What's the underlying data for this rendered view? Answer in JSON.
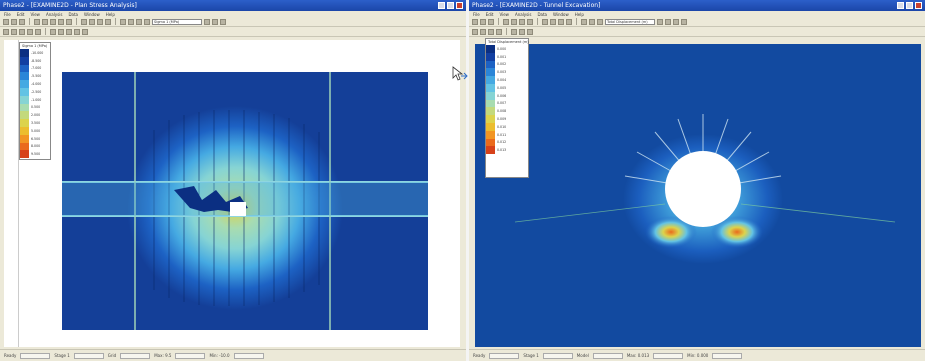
{
  "left_window": {
    "title": "Phase2 - [EXAMINE2D - Plan Stress Analysis]",
    "menu": [
      "File",
      "Edit",
      "View",
      "Analysis",
      "Data",
      "Window",
      "Help"
    ],
    "contour_select": "Sigma 1 (MPa)",
    "legend": {
      "title": "Sigma 1 (MPa)",
      "values": [
        "-10.000",
        "-8.500",
        "-7.000",
        "-5.500",
        "-4.000",
        "-2.500",
        "-1.000",
        "0.500",
        "2.000",
        "3.500",
        "5.000",
        "6.500",
        "8.000",
        "9.500"
      ],
      "colors": [
        "#0b2f82",
        "#123fa2",
        "#1d62c4",
        "#2b86d8",
        "#45a9e2",
        "#63c3e4",
        "#86d4d4",
        "#a8dcb0",
        "#c3d97c",
        "#dcd34c",
        "#ecbd2e",
        "#f29523",
        "#ea6a1c",
        "#d7421a"
      ]
    },
    "status": [
      "Ready",
      "Stage 1",
      "Grid",
      "Max: 9.5",
      "Min: -10.0"
    ]
  },
  "right_window": {
    "title": "Phase2 - [EXAMINE2D - Tunnel Excavation]",
    "menu": [
      "File",
      "Edit",
      "View",
      "Analysis",
      "Data",
      "Window",
      "Help"
    ],
    "contour_select": "Total Displacement (m)",
    "legend": {
      "title": "Total Displacement (m)",
      "values": [
        "0.000",
        "0.001",
        "0.002",
        "0.003",
        "0.004",
        "0.005",
        "0.006",
        "0.007",
        "0.008",
        "0.009",
        "0.010",
        "0.011",
        "0.012",
        "0.013"
      ],
      "colors": [
        "#0b2f82",
        "#123fa2",
        "#1d62c4",
        "#2b86d8",
        "#45a9e2",
        "#63c3e4",
        "#86d4d4",
        "#a8dcb0",
        "#c3d97c",
        "#dcd34c",
        "#ecbd2e",
        "#f29523",
        "#ea6a1c",
        "#d7421a"
      ]
    },
    "status": [
      "Ready",
      "Stage 1",
      "Model",
      "Max: 0.013",
      "Min: 0.000"
    ]
  },
  "icons": {
    "cursor": "arrow-pointer-icon"
  }
}
